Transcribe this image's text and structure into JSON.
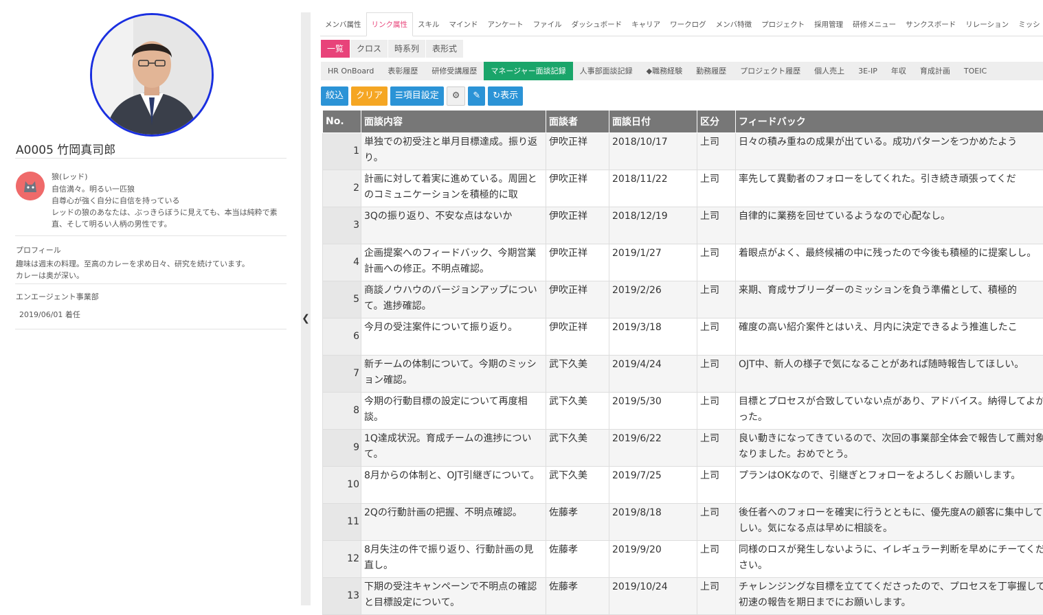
{
  "profile": {
    "name": "A0005 竹岡真司郎",
    "type_name": "狼(レッド)",
    "type_lines": [
      "自信満々。明るい一匹狼",
      "自尊心が強く自分に自信を持っている",
      "レッドの狼のあなたは、ぶっきらぼうに見えても、本当は純粋で素",
      "直、そして明るい人柄の男性です。"
    ],
    "profile_label": "プロフィール",
    "profile_lines": [
      "趣味は週末の料理。至高のカレーを求め日々、研究を続けています。",
      "カレーは奥が深い。"
    ],
    "department": "エンエージェント事業部",
    "assignment": "2019/06/01 着任"
  },
  "nav": {
    "tabs": [
      "メンバ属性",
      "リンク属性",
      "スキル",
      "マインド",
      "アンケート",
      "ファイル",
      "ダッシュボード",
      "キャリア",
      "ワークログ",
      "メンバ特徴",
      "プロジェクト",
      "採用管理",
      "研修メニュー",
      "サンクスボード",
      "リレーション",
      "ミッシ"
    ],
    "active_tab": "リンク属性",
    "view_tabs": [
      "一覧",
      "クロス",
      "時系列",
      "表形式"
    ],
    "active_view": "一覧",
    "sub_tabs": [
      "HR OnBoard",
      "表彰履歴",
      "研修受講履歴",
      "マネージャー面談記録",
      "人事部面談記録",
      "◆職務経験",
      "勤務履歴",
      "プロジェクト履歴",
      "個人売上",
      "3E-IP",
      "年収",
      "育成計画",
      "TOEIC"
    ],
    "active_sub": "マネージャー面談記録"
  },
  "toolbar": {
    "filter": "絞込",
    "clear": "クリア",
    "columns": "項目設定",
    "display": "表示"
  },
  "icons": {
    "collapse": "chevron-left-icon",
    "list": "list-icon",
    "gear": "gear-icon",
    "edit": "edit-icon",
    "refresh": "refresh-icon"
  },
  "colors": {
    "accent_pink": "#e8437a",
    "active_green": "#1aa56a",
    "button_blue": "#2b93d6",
    "button_orange": "#f5a623",
    "avatar_ring": "#1a2fe0"
  },
  "table": {
    "headers": [
      "No.",
      "面談内容",
      "面談者",
      "面談日付",
      "区分",
      "フィードバック"
    ],
    "rows": [
      {
        "no": "1",
        "content": "単独での初受注と単月目標達成。振り返り。",
        "interviewer": "伊吹正祥",
        "date": "2018/10/17",
        "category": "上司",
        "feedback": "日々の積み重ねの成果が出ている。成功パターンをつかめたよう"
      },
      {
        "no": "2",
        "content": "計画に対して着実に進めている。周囲とのコミュニケーションを積極的に取",
        "interviewer": "伊吹正祥",
        "date": "2018/11/22",
        "category": "上司",
        "feedback": "率先して異動者のフォローをしてくれた。引き続き頑張ってくだ"
      },
      {
        "no": "3",
        "content": "3Qの振り返り、不安な点はないか",
        "interviewer": "伊吹正祥",
        "date": "2018/12/19",
        "category": "上司",
        "feedback": "自律的に業務を回せているようなので心配なし。"
      },
      {
        "no": "4",
        "content": "企画提案へのフィードバック、今期営業計画への修正。不明点確認。",
        "interviewer": "伊吹正祥",
        "date": "2019/1/27",
        "category": "上司",
        "feedback": "着眼点がよく、最終候補の中に残ったので今後も積極的に提案しし。"
      },
      {
        "no": "5",
        "content": "商談ノウハウのバージョンアップについて。進捗確認。",
        "interviewer": "伊吹正祥",
        "date": "2019/2/26",
        "category": "上司",
        "feedback": "来期、育成サブリーダーのミッションを負う準備として、積極的"
      },
      {
        "no": "6",
        "content": "今月の受注案件について振り返り。",
        "interviewer": "伊吹正祥",
        "date": "2019/3/18",
        "category": "上司",
        "feedback": "確度の高い紹介案件とはいえ、月内に決定できるよう推進したこ"
      },
      {
        "no": "7",
        "content": "新チームの体制について。今期のミッション確認。",
        "interviewer": "武下久美",
        "date": "2019/4/24",
        "category": "上司",
        "feedback": "OJT中、新人の様子で気になることがあれば随時報告してほしい。"
      },
      {
        "no": "8",
        "content": "今期の行動目標の設定について再度相談。",
        "interviewer": "武下久美",
        "date": "2019/5/30",
        "category": "上司",
        "feedback": "目標とプロセスが合致していない点があり、アドバイス。納得してよかった。"
      },
      {
        "no": "9",
        "content": "1Q達成状況。育成チームの進捗について。",
        "interviewer": "武下久美",
        "date": "2019/6/22",
        "category": "上司",
        "feedback": "良い動きになってきているので、次回の事業部全体会で報告して薦対象になりました。おめでとう。"
      },
      {
        "no": "10",
        "content": "8月からの体制と、OJT引継ぎについて。",
        "interviewer": "武下久美",
        "date": "2019/7/25",
        "category": "上司",
        "feedback": "プランはOKなので、引継ぎとフォローをよろしくお願いします。"
      },
      {
        "no": "11",
        "content": "2Qの行動計画の把握、不明点確認。",
        "interviewer": "佐藤孝",
        "date": "2019/8/18",
        "category": "上司",
        "feedback": "後任者へのフォローを確実に行うとともに、優先度Aの顧客に集中してほしい。気になる点は早めに相談を。"
      },
      {
        "no": "12",
        "content": "8月失注の件で振り返り、行動計画の見直し。",
        "interviewer": "佐藤孝",
        "date": "2019/9/20",
        "category": "上司",
        "feedback": "同様のロスが発生しないように、イレギュラー判断を早めにチーてください。"
      },
      {
        "no": "13",
        "content": "下期の受注キャンペーンで不明点の確認と目標設定について。",
        "interviewer": "佐藤孝",
        "date": "2019/10/24",
        "category": "上司",
        "feedback": "チャレンジングな目標を立ててくださったので、プロセスを丁寧握して初速の報告を期日までにお願いします。"
      }
    ]
  }
}
